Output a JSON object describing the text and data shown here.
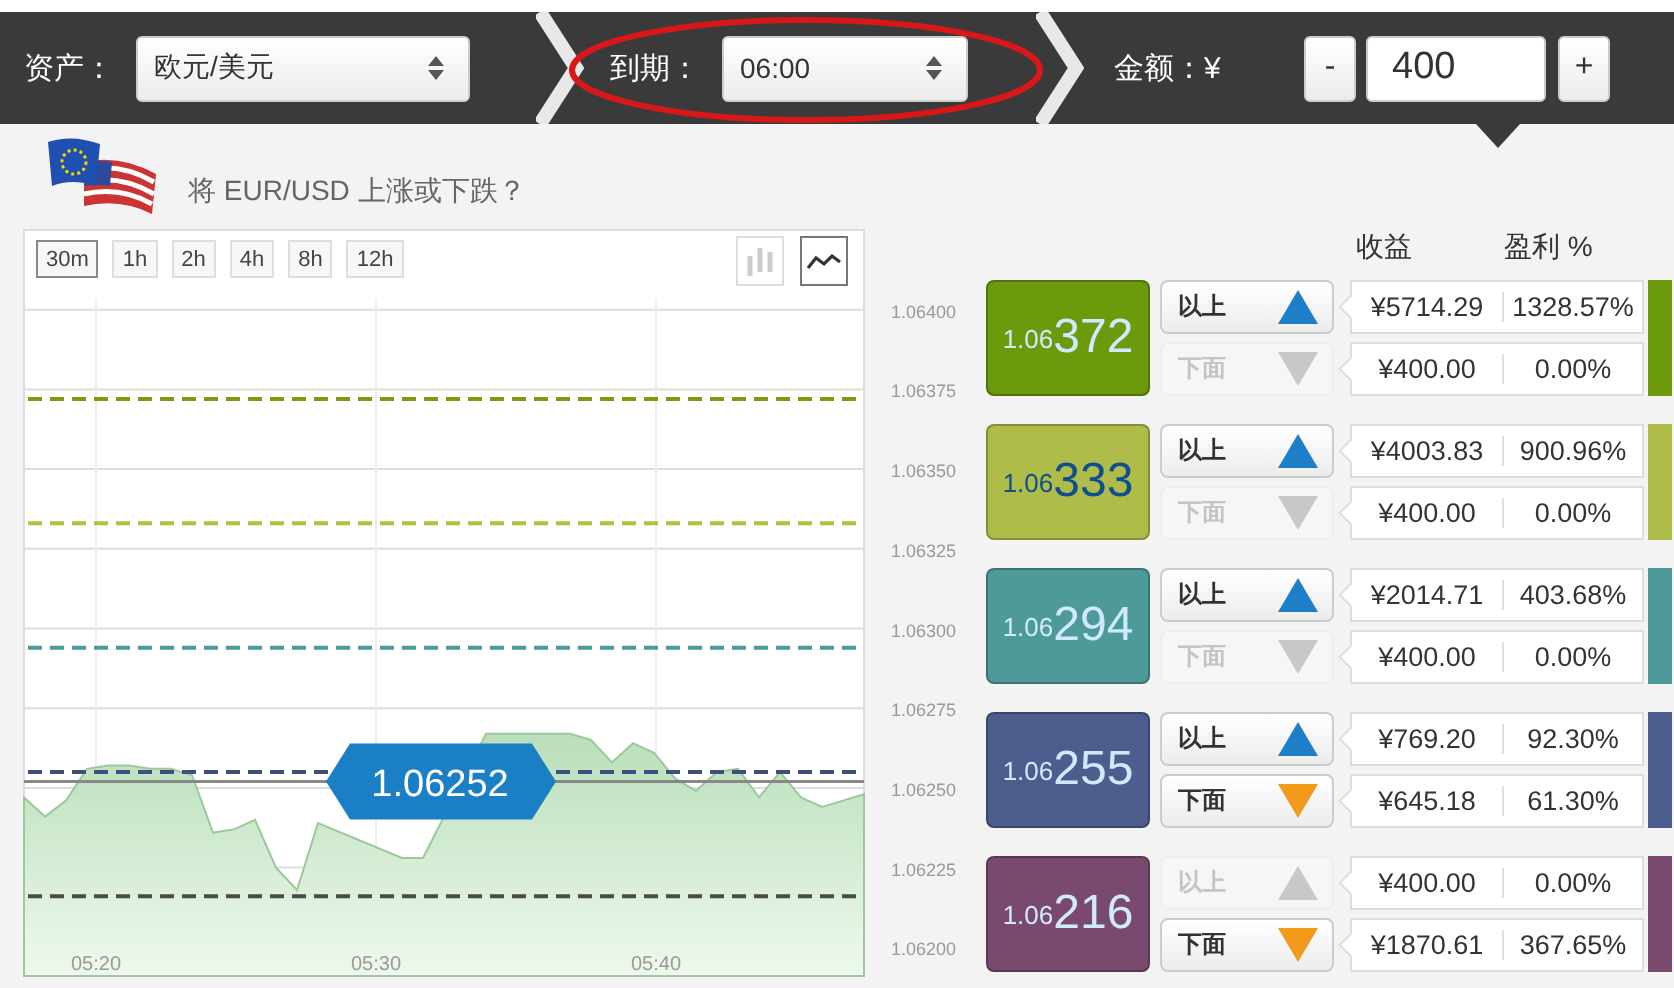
{
  "topbar": {
    "asset": {
      "label": "资产：",
      "value": "欧元/美元"
    },
    "expiry": {
      "label": "到期：",
      "value": "06:00",
      "highlighted": true
    },
    "amount": {
      "label": "金额：¥",
      "minus": "-",
      "value": "400",
      "plus": "+"
    }
  },
  "question": "将 EUR/USD 上涨或下跌？",
  "timeframes": [
    {
      "label": "30m",
      "selected": true
    },
    {
      "label": "1h",
      "selected": false
    },
    {
      "label": "2h",
      "selected": false
    },
    {
      "label": "4h",
      "selected": false
    },
    {
      "label": "8h",
      "selected": false
    },
    {
      "label": "12h",
      "selected": false
    }
  ],
  "chart_types": [
    {
      "kind": "candles",
      "selected": false
    },
    {
      "kind": "line",
      "selected": true
    }
  ],
  "time_labels": [
    "05:20",
    "05:30",
    "05:40"
  ],
  "chart_data": {
    "type": "area",
    "grid": true,
    "values": [
      1.06247,
      1.06241,
      1.06246,
      1.06256,
      1.06257,
      1.06257,
      1.06256,
      1.06256,
      1.06254,
      1.06236,
      1.06237,
      1.0624,
      1.06225,
      1.06218,
      1.06239,
      null,
      null,
      null,
      1.06228,
      1.06228,
      null,
      null,
      1.06267,
      1.06267,
      null,
      null,
      1.06267,
      1.06265,
      1.06258,
      1.06264,
      1.06261,
      1.06253,
      1.06249,
      1.06255,
      1.06256,
      1.06247,
      1.06255,
      1.06247,
      1.06244,
      1.06246,
      1.06248
    ],
    "ylim": [
      1.06191,
      1.06425
    ],
    "yticks": [
      {
        "value": 1.064,
        "label": "1.06400"
      },
      {
        "value": 1.06375,
        "label": "1.06375"
      },
      {
        "value": 1.0635,
        "label": "1.06350"
      },
      {
        "value": 1.06325,
        "label": "1.06325"
      },
      {
        "value": 1.063,
        "label": "1.06300"
      },
      {
        "value": 1.06275,
        "label": "1.06275"
      },
      {
        "value": 1.0625,
        "label": "1.06250"
      },
      {
        "value": 1.06225,
        "label": "1.06225"
      },
      {
        "value": 1.062,
        "label": "1.06200"
      }
    ],
    "ref_lines": [
      {
        "axis": "y",
        "value": 1.06372,
        "color": "#7a9a10"
      },
      {
        "axis": "y",
        "value": 1.06333,
        "color": "#b4c03c"
      },
      {
        "axis": "y",
        "value": 1.06294,
        "color": "#4e9a98"
      },
      {
        "axis": "y",
        "value": 1.06255,
        "color": "#3e4e7e"
      },
      {
        "axis": "y",
        "value": 1.06216,
        "color": "#4a4a4a"
      },
      {
        "axis": "y",
        "value": 1.06252,
        "color": "#888888"
      }
    ],
    "annotations": [
      "1.06252"
    ]
  },
  "columns": {
    "payout": "收益",
    "profit": "盈利 %"
  },
  "strikes": [
    {
      "prefix": "1.06",
      "suffix": "372",
      "color": "#6c9a0c",
      "above": {
        "label": "以上",
        "enabled": true,
        "payout": "¥5714.29",
        "profit": "1328.57%"
      },
      "below": {
        "label": "下面",
        "enabled": false,
        "payout": "¥400.00",
        "profit": "0.00%"
      }
    },
    {
      "prefix": "1.06",
      "suffix": "333",
      "color": "#b0bc4a",
      "above": {
        "label": "以上",
        "enabled": true,
        "payout": "¥4003.83",
        "profit": "900.96%"
      },
      "below": {
        "label": "下面",
        "enabled": false,
        "payout": "¥400.00",
        "profit": "0.00%"
      }
    },
    {
      "prefix": "1.06",
      "suffix": "294",
      "color": "#4e9a98",
      "above": {
        "label": "以上",
        "enabled": true,
        "payout": "¥2014.71",
        "profit": "403.68%"
      },
      "below": {
        "label": "下面",
        "enabled": false,
        "payout": "¥400.00",
        "profit": "0.00%"
      }
    },
    {
      "prefix": "1.06",
      "suffix": "255",
      "color": "#4c5d8e",
      "above": {
        "label": "以上",
        "enabled": true,
        "payout": "¥769.20",
        "profit": "92.30%"
      },
      "below": {
        "label": "下面",
        "enabled": true,
        "payout": "¥645.18",
        "profit": "61.30%"
      }
    },
    {
      "prefix": "1.06",
      "suffix": "216",
      "color": "#7a4a6e",
      "above": {
        "label": "以上",
        "enabled": false,
        "payout": "¥400.00",
        "profit": "0.00%"
      },
      "below": {
        "label": "下面",
        "enabled": true,
        "payout": "¥1870.61",
        "profit": "367.65%"
      }
    }
  ]
}
